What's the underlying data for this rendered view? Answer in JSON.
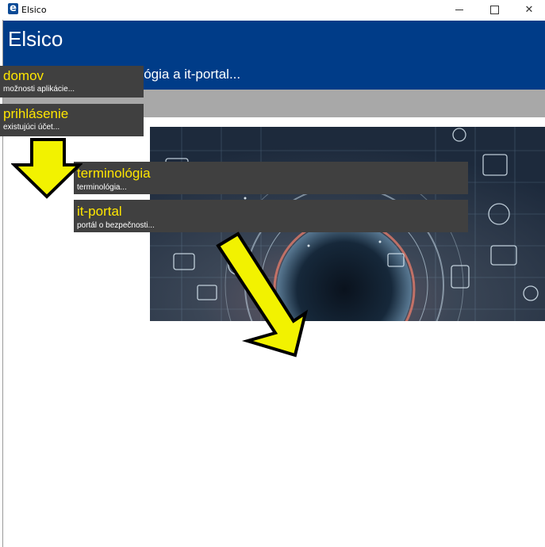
{
  "window": {
    "title": "Elsico",
    "app_icon_letter": "e",
    "close_symbol": "✕"
  },
  "header": {
    "app_title": "Elsico",
    "subtitle": "ológia a it-portal..."
  },
  "menu": [
    {
      "title": "domov",
      "description": "možnosti aplikácie..."
    },
    {
      "title": "prihlásenie",
      "description": "existujúci účet..."
    },
    {
      "title": "terminológia",
      "description": "terminológia..."
    },
    {
      "title": "it-portal",
      "description": "portál o bezpečnosti..."
    }
  ],
  "colors": {
    "header_blue": "#003c88",
    "menu_bg": "#404040",
    "menu_title": "#ffe600",
    "arrow_fill": "#f2f200",
    "gray_bar": "#a8a8a8"
  },
  "icons": [
    "app-e-icon",
    "minimize-icon",
    "maximize-icon",
    "close-icon",
    "down-arrow-icon",
    "diagonal-arrow-icon"
  ]
}
